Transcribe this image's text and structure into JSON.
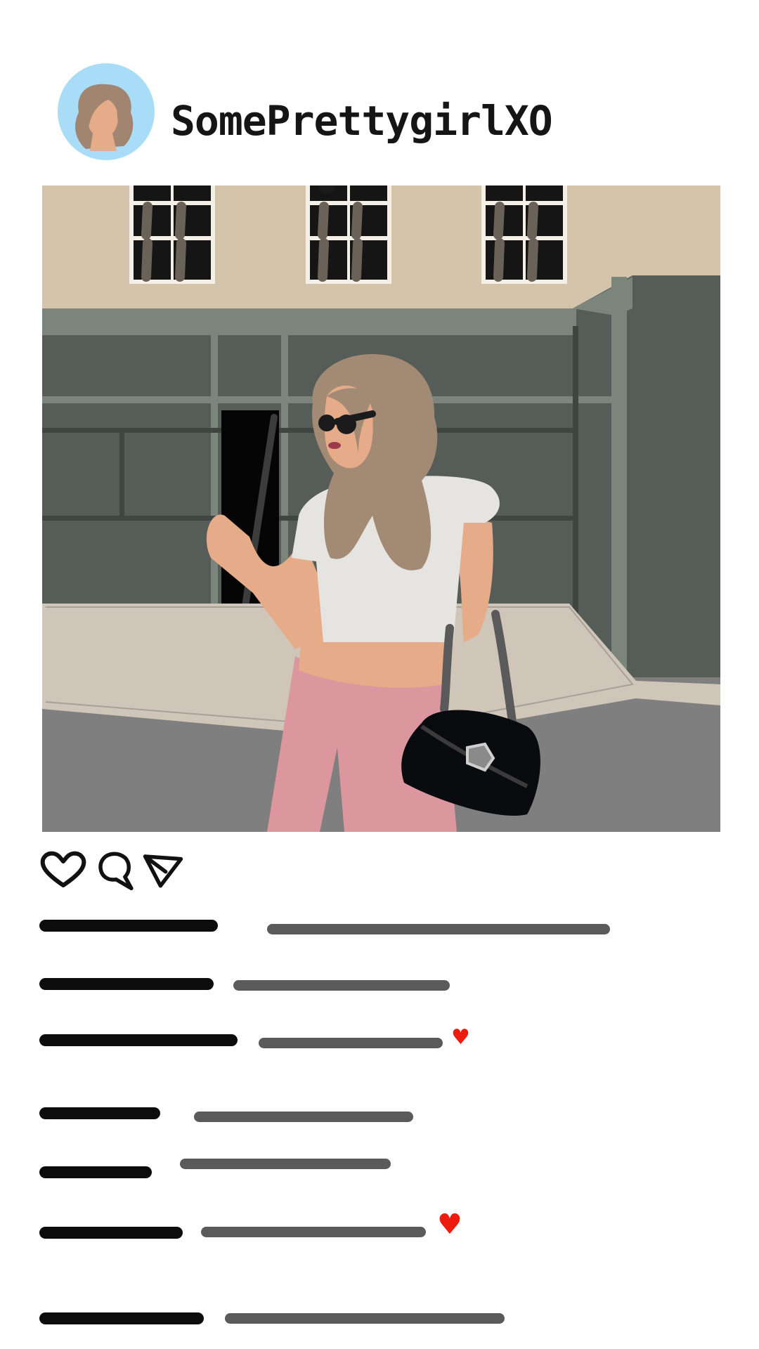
{
  "post": {
    "username": "SomePrettygirlXO"
  },
  "icons": {
    "avatar": "profile-avatar",
    "like": "heart-outline-icon",
    "comment": "comment-bubble-icon",
    "share": "send-paper-plane-icon",
    "comment_heart": "heart-filled-icon"
  },
  "colors": {
    "avatar_bg": "#a8dcf7",
    "accent_heart": "#ee1b0f",
    "username_bar": "#0c0c0c",
    "comment_bar": "#5a5a5a"
  },
  "comments": [
    {
      "heart": false,
      "heart_glyph": ""
    },
    {
      "heart": false,
      "heart_glyph": ""
    },
    {
      "heart": true,
      "heart_glyph": "♥"
    },
    {
      "heart": false,
      "heart_glyph": ""
    },
    {
      "heart": false,
      "heart_glyph": ""
    },
    {
      "heart": true,
      "heart_glyph": "♥"
    },
    {
      "heart": false,
      "heart_glyph": ""
    }
  ]
}
